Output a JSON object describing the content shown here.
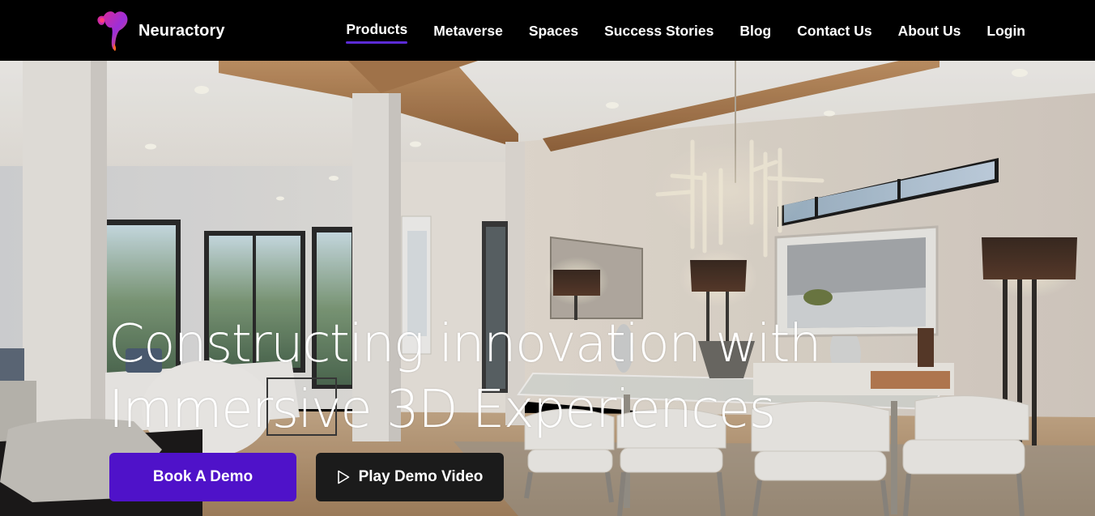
{
  "brand": {
    "name": "Neuractory",
    "logo_icon": "neuractory-logo-icon"
  },
  "nav": {
    "items": [
      {
        "label": "Products",
        "active": true
      },
      {
        "label": "Metaverse",
        "active": false
      },
      {
        "label": "Spaces",
        "active": false
      },
      {
        "label": "Success Stories",
        "active": false
      },
      {
        "label": "Blog",
        "active": false
      },
      {
        "label": "Contact Us",
        "active": false
      },
      {
        "label": "About Us",
        "active": false
      },
      {
        "label": "Login",
        "active": false
      }
    ],
    "active_underline_color": "#5b2bd6"
  },
  "hero": {
    "headline_line1": "Constructing innovation with",
    "headline_line2": "Immersive 3D Experiences",
    "primary_button": {
      "label": "Book A Demo",
      "color": "#4f12c9"
    },
    "secondary_button": {
      "label": "Play Demo Video",
      "icon": "play-icon",
      "color": "#1b1b1b"
    },
    "background": "interior photo: dining room with glass table, white chairs, chandelier, lamps and windows"
  }
}
